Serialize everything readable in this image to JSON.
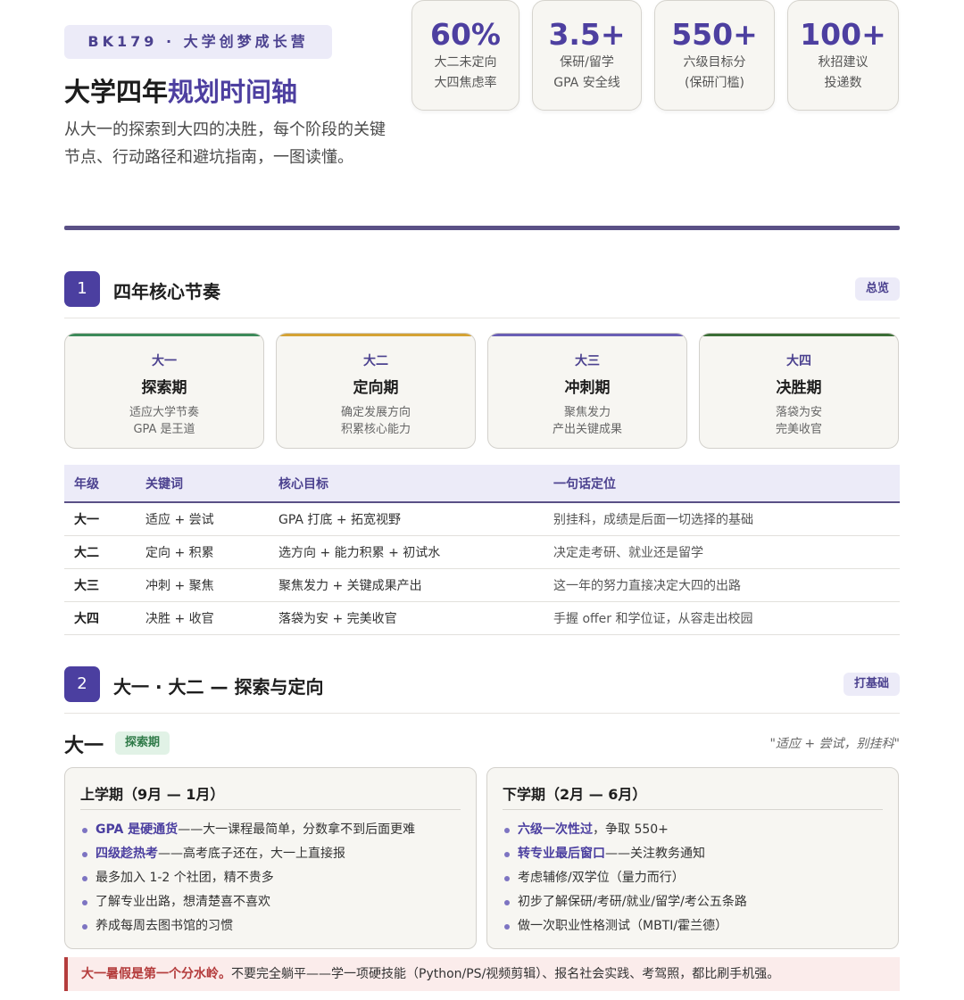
{
  "header": {
    "brand": "BK179 · 大学创梦成长营",
    "title_plain": "大学四年",
    "title_accent": "规划时间轴",
    "subtitle": "从大一的探索到大四的决胜，每个阶段的关键节点、行动路径和避坑指南，一图读懂。",
    "stats": [
      {
        "value": "60%",
        "label": "大二未定向\n大四焦虑率"
      },
      {
        "value": "3.5+",
        "label": "保研/留学\nGPA 安全线"
      },
      {
        "value": "550+",
        "label": "六级目标分\n(保研门槛)"
      },
      {
        "value": "100+",
        "label": "秋招建议\n投递数"
      }
    ]
  },
  "section1": {
    "number": "1",
    "title": "四年核心节奏",
    "badge": "总览",
    "phases": [
      {
        "year": "大一",
        "name": "探索期",
        "desc": "适应大学节奏\nGPA 是王道",
        "color": "#3d8a5a"
      },
      {
        "year": "大二",
        "name": "定向期",
        "desc": "确定发展方向\n积累核心能力",
        "color": "#d4a234"
      },
      {
        "year": "大三",
        "name": "冲刺期",
        "desc": "聚焦发力\n产出关键成果",
        "color": "#6a5fb5"
      },
      {
        "year": "大四",
        "name": "决胜期",
        "desc": "落袋为安\n完美收官",
        "color": "#3b6e36"
      }
    ],
    "table": {
      "headers": [
        "年级",
        "关键词",
        "核心目标",
        "一句话定位"
      ],
      "rows": [
        [
          "大一",
          "适应 + 尝试",
          "GPA 打底 + 拓宽视野",
          "别挂科，成绩是后面一切选择的基础"
        ],
        [
          "大二",
          "定向 + 积累",
          "选方向 + 能力积累 + 初试水",
          "决定走考研、就业还是留学"
        ],
        [
          "大三",
          "冲刺 + 聚焦",
          "聚焦发力 + 关键成果产出",
          "这一年的努力直接决定大四的出路"
        ],
        [
          "大四",
          "决胜 + 收官",
          "落袋为安 + 完美收官",
          "手握 offer 和学位证，从容走出校园"
        ]
      ]
    }
  },
  "section2": {
    "number": "2",
    "title": "大一 · 大二 — 探索与定向",
    "badge": "打基础",
    "year": "大一",
    "year_tag": "探索期",
    "quote": "\"适应 + 尝试，别挂科\"",
    "terms": [
      {
        "title": "上学期（9月 — 1月）",
        "items": [
          {
            "hl": "GPA 是硬通货",
            "text": "——大一课程最简单，分数拿不到后面更难"
          },
          {
            "hl": "四级趁热考",
            "text": "——高考底子还在，大一上直接报"
          },
          {
            "hl": "",
            "text": "最多加入 1-2 个社团，精不贵多"
          },
          {
            "hl": "",
            "text": "了解专业出路，想清楚喜不喜欢"
          },
          {
            "hl": "",
            "text": "养成每周去图书馆的习惯"
          }
        ]
      },
      {
        "title": "下学期（2月 — 6月）",
        "items": [
          {
            "hl": "六级一次性过",
            "text": "，争取 550+"
          },
          {
            "hl": "转专业最后窗口",
            "text": "——关注教务通知"
          },
          {
            "hl": "",
            "text": "考虑辅修/双学位（量力而行）"
          },
          {
            "hl": "",
            "text": "初步了解保研/考研/就业/留学/考公五条路"
          },
          {
            "hl": "",
            "text": "做一次职业性格测试（MBTI/霍兰德）"
          }
        ]
      }
    ],
    "alert_hl": "大一暑假是第一个分水岭。",
    "alert_text": "不要完全躺平——学一项硬技能（Python/PS/视频剪辑）、报名社会实践、考驾照，都比刷手机强。"
  }
}
